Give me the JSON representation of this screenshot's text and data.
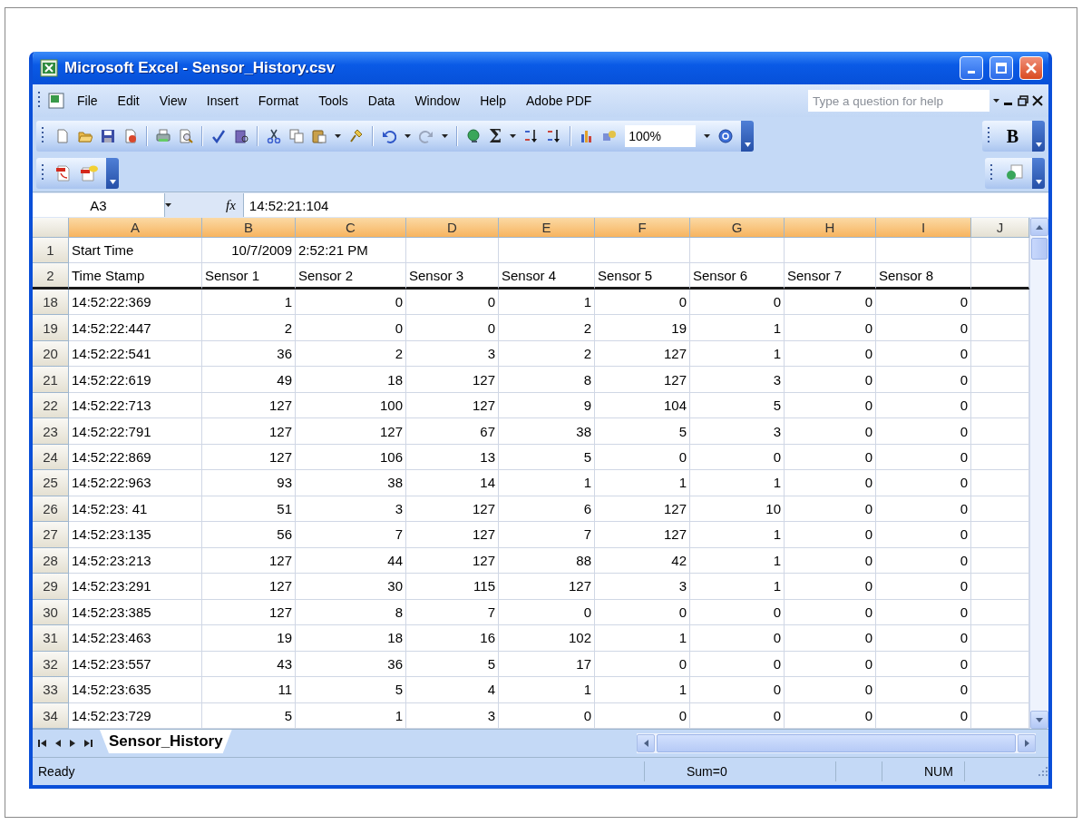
{
  "window": {
    "title": "Microsoft Excel - Sensor_History.csv"
  },
  "menu": [
    "File",
    "Edit",
    "View",
    "Insert",
    "Format",
    "Tools",
    "Data",
    "Window",
    "Help",
    "Adobe PDF"
  ],
  "help_search": {
    "placeholder": "Type a question for help"
  },
  "toolbar": {
    "sum_symbol": "Σ",
    "zoom": "100%"
  },
  "formatting_toolbar": {
    "bold_label": "B"
  },
  "formula_bar": {
    "name_box": "A3",
    "function_label": "fx",
    "value": "14:52:21:104"
  },
  "columns": [
    {
      "label": "A",
      "selected": true
    },
    {
      "label": "B",
      "selected": true
    },
    {
      "label": "C",
      "selected": true
    },
    {
      "label": "D",
      "selected": true
    },
    {
      "label": "E",
      "selected": true
    },
    {
      "label": "F",
      "selected": true
    },
    {
      "label": "G",
      "selected": true
    },
    {
      "label": "H",
      "selected": true
    },
    {
      "label": "I",
      "selected": true
    },
    {
      "label": "J",
      "selected": false
    }
  ],
  "rows": [
    {
      "number": "1",
      "kind": "info",
      "cells": [
        "Start Time",
        "10/7/2009",
        "2:52:21 PM"
      ]
    },
    {
      "number": "2",
      "kind": "header",
      "cells": [
        "Time Stamp",
        "Sensor 1",
        "Sensor 2",
        "Sensor 3",
        "Sensor 4",
        "Sensor 5",
        "Sensor 6",
        "Sensor 7",
        "Sensor 8"
      ]
    },
    {
      "number": "18",
      "kind": "data",
      "cells": [
        "14:52:22:369",
        "1",
        "0",
        "0",
        "1",
        "0",
        "0",
        "0",
        "0"
      ]
    },
    {
      "number": "19",
      "kind": "data",
      "cells": [
        "14:52:22:447",
        "2",
        "0",
        "0",
        "2",
        "19",
        "1",
        "0",
        "0"
      ]
    },
    {
      "number": "20",
      "kind": "data",
      "cells": [
        "14:52:22:541",
        "36",
        "2",
        "3",
        "2",
        "127",
        "1",
        "0",
        "0"
      ]
    },
    {
      "number": "21",
      "kind": "data",
      "cells": [
        "14:52:22:619",
        "49",
        "18",
        "127",
        "8",
        "127",
        "3",
        "0",
        "0"
      ]
    },
    {
      "number": "22",
      "kind": "data",
      "cells": [
        "14:52:22:713",
        "127",
        "100",
        "127",
        "9",
        "104",
        "5",
        "0",
        "0"
      ]
    },
    {
      "number": "23",
      "kind": "data",
      "cells": [
        "14:52:22:791",
        "127",
        "127",
        "67",
        "38",
        "5",
        "3",
        "0",
        "0"
      ]
    },
    {
      "number": "24",
      "kind": "data",
      "cells": [
        "14:52:22:869",
        "127",
        "106",
        "13",
        "5",
        "0",
        "0",
        "0",
        "0"
      ]
    },
    {
      "number": "25",
      "kind": "data",
      "cells": [
        "14:52:22:963",
        "93",
        "38",
        "14",
        "1",
        "1",
        "1",
        "0",
        "0"
      ]
    },
    {
      "number": "26",
      "kind": "data",
      "cells": [
        "14:52:23: 41",
        "51",
        "3",
        "127",
        "6",
        "127",
        "10",
        "0",
        "0"
      ]
    },
    {
      "number": "27",
      "kind": "data",
      "cells": [
        "14:52:23:135",
        "56",
        "7",
        "127",
        "7",
        "127",
        "1",
        "0",
        "0"
      ]
    },
    {
      "number": "28",
      "kind": "data",
      "cells": [
        "14:52:23:213",
        "127",
        "44",
        "127",
        "88",
        "42",
        "1",
        "0",
        "0"
      ]
    },
    {
      "number": "29",
      "kind": "data",
      "cells": [
        "14:52:23:291",
        "127",
        "30",
        "115",
        "127",
        "3",
        "1",
        "0",
        "0"
      ]
    },
    {
      "number": "30",
      "kind": "data",
      "cells": [
        "14:52:23:385",
        "127",
        "8",
        "7",
        "0",
        "0",
        "0",
        "0",
        "0"
      ]
    },
    {
      "number": "31",
      "kind": "data",
      "cells": [
        "14:52:23:463",
        "19",
        "18",
        "16",
        "102",
        "1",
        "0",
        "0",
        "0"
      ]
    },
    {
      "number": "32",
      "kind": "data",
      "cells": [
        "14:52:23:557",
        "43",
        "36",
        "5",
        "17",
        "0",
        "0",
        "0",
        "0"
      ]
    },
    {
      "number": "33",
      "kind": "data",
      "cells": [
        "14:52:23:635",
        "11",
        "5",
        "4",
        "1",
        "1",
        "0",
        "0",
        "0"
      ]
    },
    {
      "number": "34",
      "kind": "data",
      "cells": [
        "14:52:23:729",
        "5",
        "1",
        "3",
        "0",
        "0",
        "0",
        "0",
        "0"
      ]
    }
  ],
  "sheet_tabs": [
    {
      "label": "Sensor_History",
      "selected": true
    }
  ],
  "status_bar": {
    "mode": "Ready",
    "sum": "Sum=0",
    "num_lock": "NUM"
  }
}
